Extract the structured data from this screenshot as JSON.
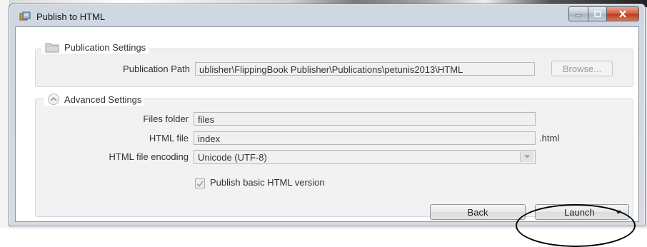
{
  "window": {
    "title": "Publish to HTML"
  },
  "titlebar": {
    "app_icon": "publisher-icon",
    "minimize_icon": "minimize-icon",
    "maximize_icon": "maximize-icon",
    "close_icon": "close-icon"
  },
  "publication": {
    "header": "Publication Settings",
    "header_icon": "folder-icon",
    "path_label": "Publication Path",
    "path_value": "ublisher\\FlippingBook Publisher\\Publications\\petunis2013\\HTML",
    "browse_label": "Browse..."
  },
  "advanced": {
    "header": "Advanced Settings",
    "header_icon": "collapse-chevron-icon",
    "files_folder_label": "Files folder",
    "files_folder_value": "files",
    "html_file_label": "HTML file",
    "html_file_value": "index",
    "html_file_ext": ".html",
    "encoding_label": "HTML file encoding",
    "encoding_value": "Unicode (UTF-8)",
    "basic_html_label": "Publish basic HTML version",
    "basic_html_checked": true
  },
  "footer": {
    "back_label": "Back",
    "launch_label": "Launch"
  }
}
